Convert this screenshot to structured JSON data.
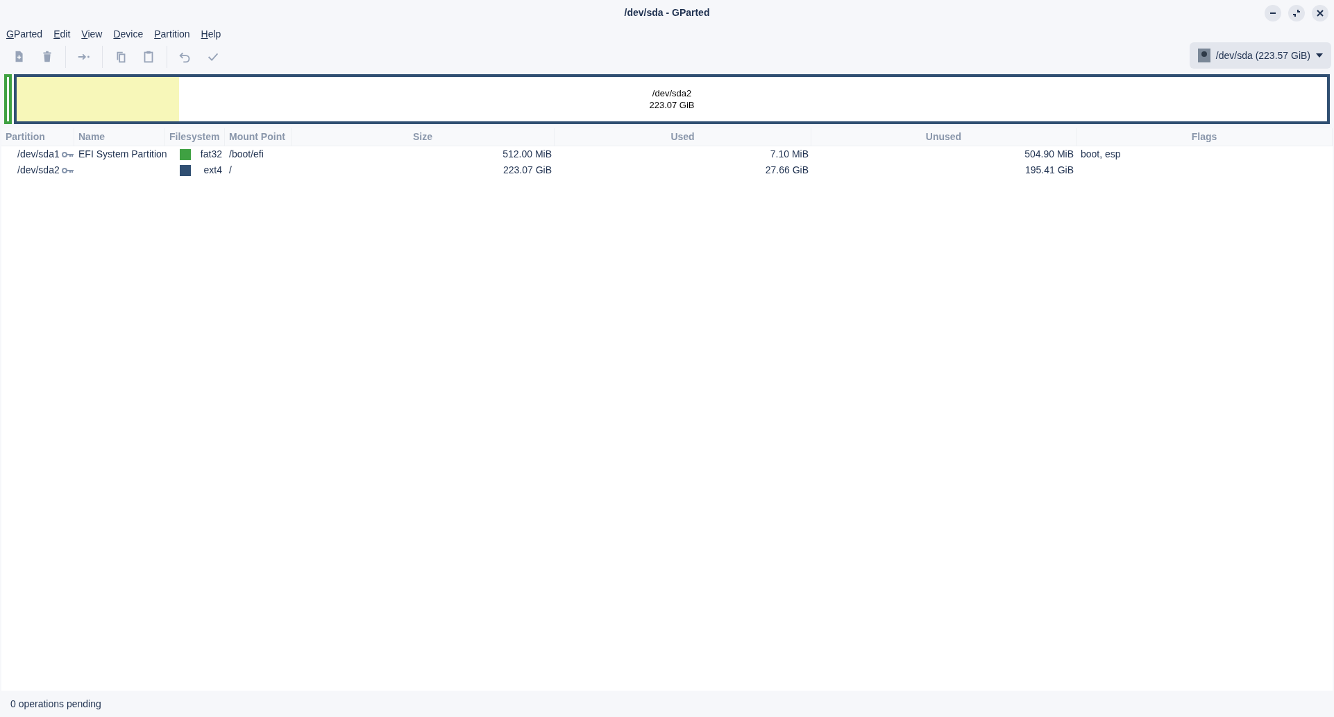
{
  "window": {
    "title": "/dev/sda - GParted"
  },
  "menu": [
    "GParted",
    "Edit",
    "View",
    "Device",
    "Partition",
    "Help"
  ],
  "toolbar": [
    {
      "kind": "new",
      "disabled": true
    },
    {
      "kind": "delete",
      "disabled": true
    },
    {
      "kind": "sep"
    },
    {
      "kind": "resize",
      "disabled": true
    },
    {
      "kind": "sep"
    },
    {
      "kind": "copy",
      "disabled": true
    },
    {
      "kind": "paste",
      "disabled": true
    },
    {
      "kind": "sep"
    },
    {
      "kind": "undo",
      "disabled": true
    },
    {
      "kind": "apply",
      "disabled": true
    }
  ],
  "device_selector": {
    "label": "/dev/sda (223.57 GiB)"
  },
  "disk_map": [
    {
      "color": "#3fa142"
    },
    {
      "color": "#304f72",
      "level": 0.124,
      "label": "/dev/sda2",
      "size": "223.07 GiB"
    }
  ],
  "table": {
    "columns": [
      "Partition",
      "Name",
      "Filesystem",
      "Mount Point",
      "Size",
      "Used",
      "Unused",
      "Flags"
    ],
    "rows": [
      {
        "partition": "/dev/sda1",
        "name": "EFI System Partition",
        "color": "#3fa142",
        "filesystem": "fat32",
        "mount_point": "/boot/efi",
        "size": "512.00 MiB",
        "used": "7.10 MiB",
        "unused": "504.90 MiB",
        "flags": "boot, esp"
      },
      {
        "partition": "/dev/sda2",
        "color": "#304f72",
        "filesystem": "ext4",
        "mount_point": "/",
        "size": "223.07 GiB",
        "used": "27.66 GiB",
        "unused": "195.41 GiB"
      }
    ]
  },
  "status_bar": "0 operations pending"
}
